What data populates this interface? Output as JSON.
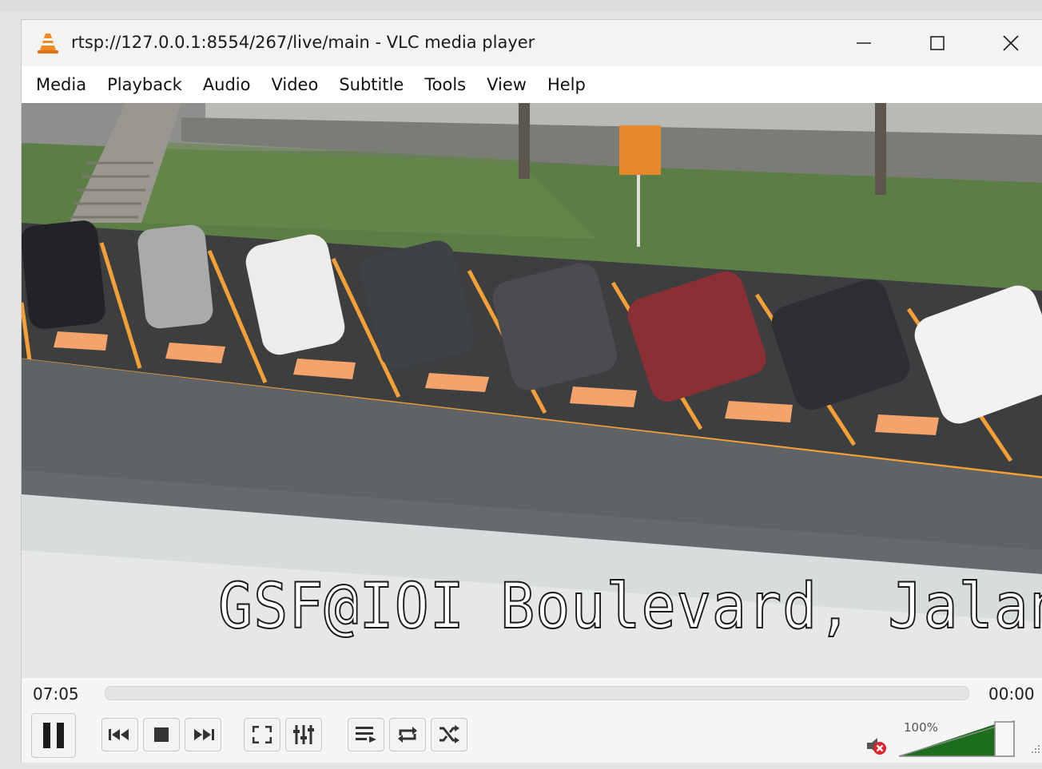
{
  "window": {
    "title": "rtsp://127.0.0.1:8554/267/live/main - VLC media player",
    "app_icon": "vlc-cone-icon",
    "controls": [
      "minimize-icon",
      "maximize-icon",
      "close-icon"
    ]
  },
  "menu": {
    "items": [
      "Media",
      "Playback",
      "Audio",
      "Video",
      "Subtitle",
      "Tools",
      "View",
      "Help"
    ]
  },
  "video": {
    "overlay_text": "GSF@IOI Boulevard, Jalan K"
  },
  "seek": {
    "elapsed": "07:05",
    "total": "00:00",
    "progress": 0
  },
  "controls": {
    "play_pause": "pause-icon",
    "previous": "previous-icon",
    "stop": "stop-icon",
    "next": "next-icon",
    "fullscreen": "fullscreen-icon",
    "extended_settings": "extended-settings-icon",
    "playlist": "playlist-icon",
    "loop": "loop-icon",
    "shuffle": "shuffle-icon"
  },
  "volume": {
    "level_label": "100%",
    "level": 1.0,
    "muted": true,
    "mute_icon": "speaker-muted-icon"
  },
  "colors": {
    "vlc_orange": "#f08a24",
    "parking_line": "#f4a036",
    "grass": "#5d7d46"
  }
}
